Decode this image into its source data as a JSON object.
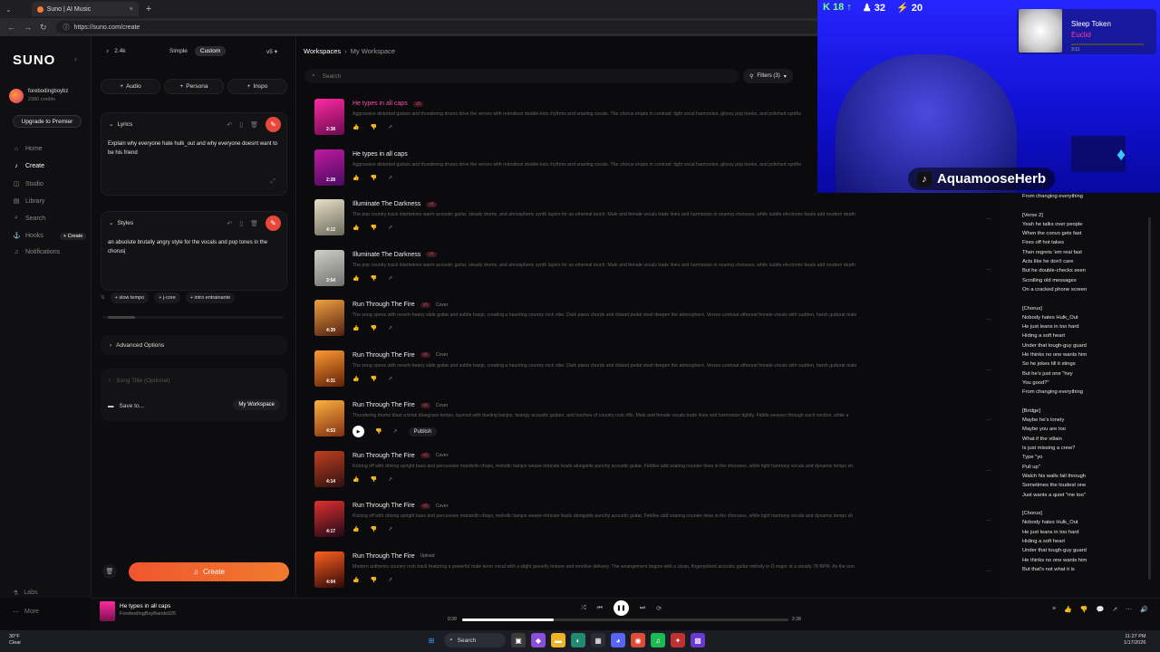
{
  "browser": {
    "tab_title": "Suno | AI Music",
    "new_tab": "+",
    "close": "×",
    "url": "https://suno.com/create"
  },
  "sidebar": {
    "logo": "SUNO",
    "user_name": "forebodingboybz",
    "credits": "2380 credits",
    "upgrade_label": "Upgrade to Premier",
    "items": [
      {
        "label": "Home",
        "icon": "home-icon"
      },
      {
        "label": "Create",
        "icon": "create-icon"
      },
      {
        "label": "Studio",
        "icon": "studio-icon"
      },
      {
        "label": "Library",
        "icon": "library-icon"
      },
      {
        "label": "Search",
        "icon": "search-icon"
      },
      {
        "label": "Hooks",
        "icon": "hooks-icon"
      },
      {
        "label": "Notifications",
        "icon": "bell-icon"
      }
    ],
    "create_tag": "+ Create",
    "footer": [
      {
        "label": "Labs"
      },
      {
        "label": "More"
      }
    ]
  },
  "create_panel": {
    "credits_count": "2.4k",
    "mode_simple": "Simple",
    "mode_custom": "Custom",
    "version": "v5",
    "chips": [
      "Audio",
      "Persona",
      "Inspo"
    ],
    "lyrics_label": "Lyrics",
    "lyrics_text": "Explain why everyone hate hulk_out and why everyone doesnt want to be his friend",
    "styles_label": "Styles",
    "styles_text": "an absolute brutally angry style for the vocals and pop tones in the chorus|",
    "style_tags": [
      "slow tempo",
      "j-core",
      "intro entrainante"
    ],
    "advanced_label": "Advanced Options",
    "song_title_placeholder": "Song Title (Optional)",
    "save_to_label": "Save to...",
    "workspace_label": "My Workspace",
    "create_label": "Create"
  },
  "main": {
    "crumb_root": "Workspaces",
    "crumb_sub": "My Workspace",
    "search_placeholder": "Search",
    "filters_label": "Filters (3)",
    "songs": [
      {
        "title": "He types in all caps",
        "badge": "v5",
        "type": "",
        "duration": "2:38",
        "desc": "Aggressive distorted guitars and thundering drums drive the verses with relentless double-kick rhythms and snarling vocals. The chorus erupts in contrast: light vocal harmonies, glossy pop hooks, and polished synths",
        "color_a": "#ff2aa0",
        "color_b": "#6a0a50",
        "hot": true
      },
      {
        "title": "He types in all caps",
        "badge": "",
        "type": "",
        "duration": "2:28",
        "desc": "Aggressive distorted guitars and thundering drums drive the verses with relentless double-kick rhythms and snarling vocals. The chorus erupts in contrast: light vocal harmonies, glossy pop hooks, and polished synths",
        "color_a": "#c01aa0",
        "color_b": "#4a0a60",
        "hot": false
      },
      {
        "title": "Illuminate The Darkness",
        "badge": "v5",
        "type": "",
        "duration": "4:12",
        "desc": "The pop country track intertwines warm acoustic guitar, steady drums, and atmospheric synth layers for an ethereal touch. Male and female vocals trade lines and harmonize in soaring choruses, while subtle electronic beats add modern depth",
        "color_a": "#e8e0c8",
        "color_b": "#6a6a5a",
        "hot": false
      },
      {
        "title": "Illuminate The Darkness",
        "badge": "v5",
        "type": "",
        "duration": "3:54",
        "desc": "The pop country track intertwines warm acoustic guitar, steady drums, and atmospheric synth layers for an ethereal touch. Male and female vocals trade lines and harmonize in soaring choruses, while subtle electronic beats add modern depth",
        "color_a": "#d0d0c8",
        "color_b": "#707070",
        "hot": false
      },
      {
        "title": "Run Through The Fire",
        "badge": "v5",
        "type": "Cover",
        "duration": "4:39",
        "desc": "The song opens with reverb-heavy slide guitar and subtle banjo, creating a haunting country rock vibe. Dark piano chords and distant pedal steel deepen the atmosphere. Verses contrast ethereal female vocals with sudden, harsh guttural male",
        "color_a": "#f0a040",
        "color_b": "#502010",
        "hot": false
      },
      {
        "title": "Run Through The Fire",
        "badge": "v5",
        "type": "Cover",
        "duration": "4:31",
        "desc": "The song opens with reverb-heavy slide guitar and subtle banjo, creating a haunting country rock vibe. Dark piano chords and distant pedal steel deepen the atmosphere. Verses contrast ethereal female vocals with sudden, harsh guttural male",
        "color_a": "#ff9a30",
        "color_b": "#602008",
        "hot": false
      },
      {
        "title": "Run Through The Fire",
        "badge": "v5",
        "type": "Cover",
        "duration": "4:53",
        "desc": "Thundering drums blast a brisk bluegrass tempo, layered with dueling banjos, twangy acoustic guitars, and touches of country rock riffs. Male and female vocals trade lines and harmonize tightly. Fiddle weaves through each section, while a",
        "color_a": "#ffb040",
        "color_b": "#803010",
        "hot": false,
        "publish": "Publish"
      },
      {
        "title": "Run Through The Fire",
        "badge": "v5",
        "type": "Cover",
        "duration": "4:14",
        "desc": "Kicking off with driving upright bass and percussive mandolin chops, melodic banjos weave intricate leads alongside punchy acoustic guitar. Fiddles add soaring counter-lines in the choruses, while tight harmony vocals and dynamic tempo sh",
        "color_a": "#c04020",
        "color_b": "#301010",
        "hot": false
      },
      {
        "title": "Run Through The Fire",
        "badge": "v5",
        "type": "Cover",
        "duration": "4:17",
        "desc": "Kicking off with driving upright bass and percussive mandolin chops, melodic banjos weave intricate leads alongside punchy acoustic guitar. Fiddles add soaring counter-lines in the choruses, while tight harmony vocals and dynamic tempo sh",
        "color_a": "#e03030",
        "color_b": "#200818",
        "hot": false
      },
      {
        "title": "Run Through The Fire",
        "badge": "",
        "type": "Upload",
        "duration": "4:04",
        "desc": "Modern anthemic country rock track featuring a powerful male tenor vocal with a slight gravelly texture and emotive delivery. The arrangement begins with a clean, fingerpicked acoustic guitar melody in D major at a steady 78 BPM. As the son",
        "color_a": "#ff6020",
        "color_b": "#300808",
        "hot": false
      }
    ]
  },
  "lyrics_panel": {
    "text": "From changing everything\n\n[Verse 2]\nYeah he talks over people\nWhen the convo gets fast\nFires off hot takes\nThen regrets 'em real fast\nActs like he don't care\nBut he double-checks seen\nScrolling old messages\nOn a cracked phone screen\n\n[Chorus]\nNobody hates Hulk_Out\nHe just leans in too hard\nHiding a soft heart\nUnder that tough-guy guard\nHe thinks no one wants him\nSo he jokes till it stings\nBut he's just one \"hey\nYou good?\"\nFrom changing everything\n\n[Bridge]\nMaybe he's lonely\nMaybe you are too\nWhat if the villain\nIs just missing a crew?\nType \"yo\nPull up\"\nWatch his walls fall through\nSometimes the loudest one\nJust wants a quiet \"me too\"\n\n[Chorus]\nNobody hates Hulk_Out\nHe just leans in too hard\nHiding a soft heart\nUnder that tough-guy guard\nHe thinks no one wants him\nBut that's not what it is"
  },
  "overlay": {
    "stat1": "K 18 ↑",
    "stat2": "♟ 32",
    "stat3": "⚡ 20",
    "now_playing_artist": "Sleep Token",
    "now_playing_track": "Euclid",
    "now_playing_time": "3:11",
    "tiktok_handle": "AquamooseHerb"
  },
  "player": {
    "title": "He types in all caps",
    "artist": "ForebodingBoyBands925",
    "elapsed": "0:39",
    "total": "2:38",
    "progress": 0.28
  },
  "taskbar": {
    "weather_temp": "30°F",
    "weather_desc": "Clear",
    "search_label": "Search",
    "time": "11:27 PM",
    "date": "1/17/2026"
  }
}
